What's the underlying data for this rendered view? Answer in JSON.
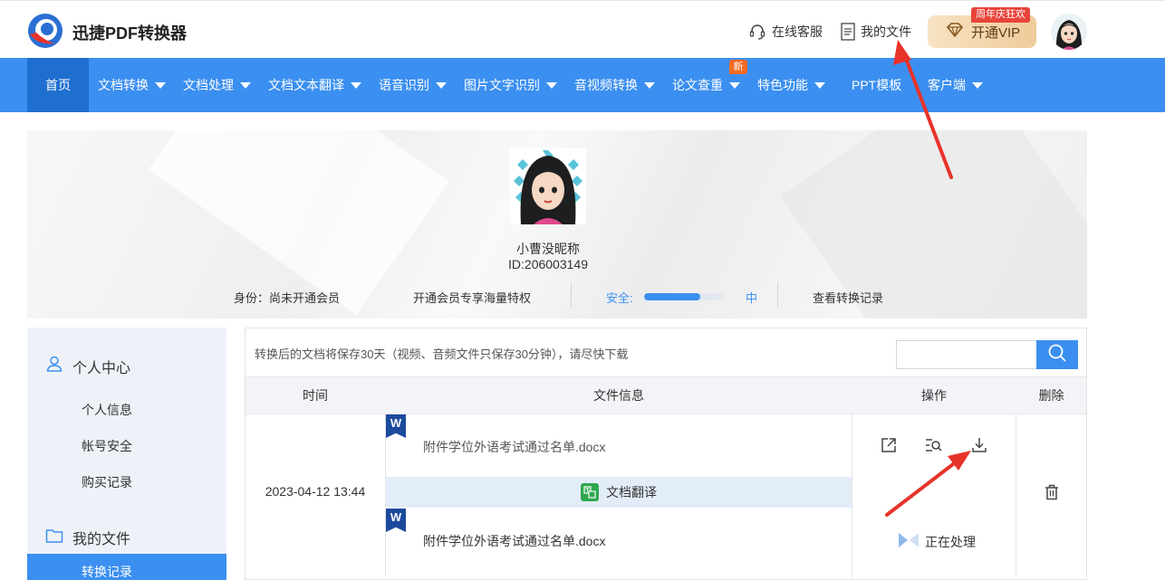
{
  "header": {
    "brand": "迅捷PDF转换器",
    "online_service": "在线客服",
    "my_files": "我的文件",
    "vip_button": "开通VIP",
    "vip_badge": "周年庆狂欢"
  },
  "nav": {
    "items": [
      {
        "label": "首页",
        "dropdown": false
      },
      {
        "label": "文档转换",
        "dropdown": true
      },
      {
        "label": "文档处理",
        "dropdown": true
      },
      {
        "label": "文档文本翻译",
        "dropdown": true
      },
      {
        "label": "语音识别",
        "dropdown": true
      },
      {
        "label": "图片文字识别",
        "dropdown": true
      },
      {
        "label": "音视频转换",
        "dropdown": true
      },
      {
        "label": "论文查重",
        "dropdown": true
      },
      {
        "label": "特色功能",
        "dropdown": true
      },
      {
        "label": "PPT模板",
        "dropdown": false
      },
      {
        "label": "客户端",
        "dropdown": true
      }
    ],
    "new_badge": "新"
  },
  "profile": {
    "nickname": "小曹没昵称",
    "user_id": "ID:206003149",
    "identity": "身份：尚未开通会员",
    "member_promo": "开通会员专享海量特权",
    "security_label": "安全:",
    "security_level": "中",
    "security_fraction": 0.7,
    "view_records": "查看转换记录"
  },
  "sidebar": {
    "personal_center": "个人中心",
    "personal_items": [
      "个人信息",
      "帐号安全",
      "购买记录"
    ],
    "my_files": "我的文件",
    "active_item": "转换记录"
  },
  "panel": {
    "notice": "转换后的文档将保存30天（视频、音频文件只保存30分钟），请尽快下载",
    "search_value": "",
    "columns": [
      "时间",
      "文件信息",
      "操作",
      "删除"
    ],
    "rows": [
      {
        "time": "2023-04-12 13:44",
        "source_file": "附件学位外语考试通过名单.docx",
        "conversion": "文档翻译",
        "output_file": "附件学位外语考试通过名单.docx",
        "status": "正在处理"
      }
    ],
    "file_badge": "W"
  },
  "colors": {
    "primary": "#3b8ff0",
    "nav_active": "#1f6fd0",
    "sidebar_bg": "#eef2f8",
    "vip_tag": "#e8443a",
    "new_badge": "#f26a23",
    "arrow": "#e8332a"
  },
  "icons": {
    "service": "headset-icon",
    "files": "document-icon",
    "vip": "diamond-icon",
    "open": "open-external-icon",
    "preview": "preview-search-icon",
    "download": "download-icon",
    "delete": "trash-icon",
    "search": "search-icon"
  }
}
